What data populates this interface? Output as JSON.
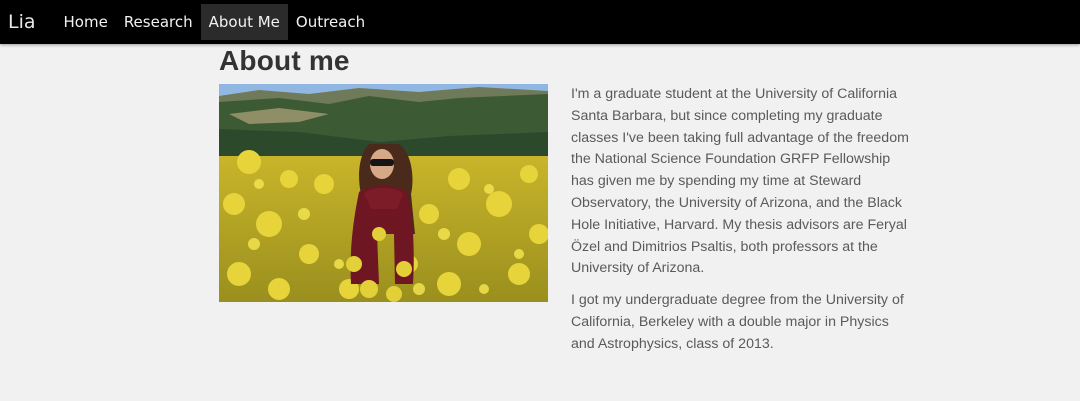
{
  "nav": {
    "brand": "Lia",
    "items": [
      {
        "label": "Home"
      },
      {
        "label": "Research"
      },
      {
        "label": "About Me"
      },
      {
        "label": "Outreach"
      }
    ],
    "active_index": 2
  },
  "main": {
    "title": "About me",
    "paragraphs": [
      "I'm a graduate student at the University of California Santa Barbara, but since completing my graduate classes I've been taking full advantage of the freedom the National Science Foundation GRFP Fellowship has given me by spending my time at Steward Observatory, the University of Arizona, and the Black Hole Initiative, Harvard. My thesis advisors are Feryal Özel and Dimitrios Psaltis, both professors at the University of Arizona.",
      "I got my undergraduate degree from the University of California, Berkeley with a double major in Physics and Astrophysics, class of 2013."
    ]
  },
  "colors": {
    "nav_bg": "#000000",
    "active_bg": "#2b2b2b",
    "page_bg": "#f1f1f1"
  }
}
